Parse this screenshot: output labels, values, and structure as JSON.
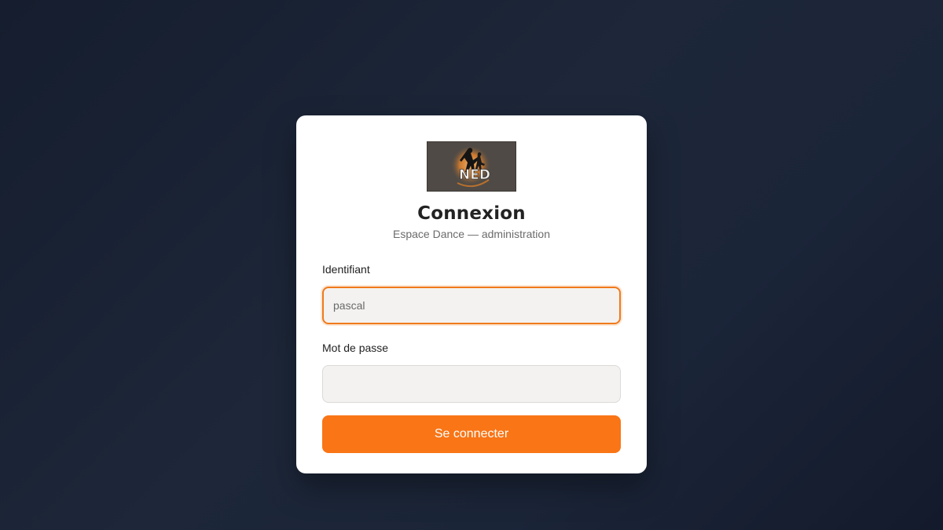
{
  "login": {
    "logo_text": "NED",
    "title": "Connexion",
    "subtitle": "Espace Dance — administration",
    "username": {
      "label": "Identifiant",
      "value": "pascal"
    },
    "password": {
      "label": "Mot de passe",
      "value": ""
    },
    "submit_label": "Se connecter"
  },
  "colors": {
    "accent": "#f97516",
    "background": "#1b2538",
    "card": "#ffffff"
  },
  "icons": {
    "logo": "dancer-silhouette-logo"
  }
}
